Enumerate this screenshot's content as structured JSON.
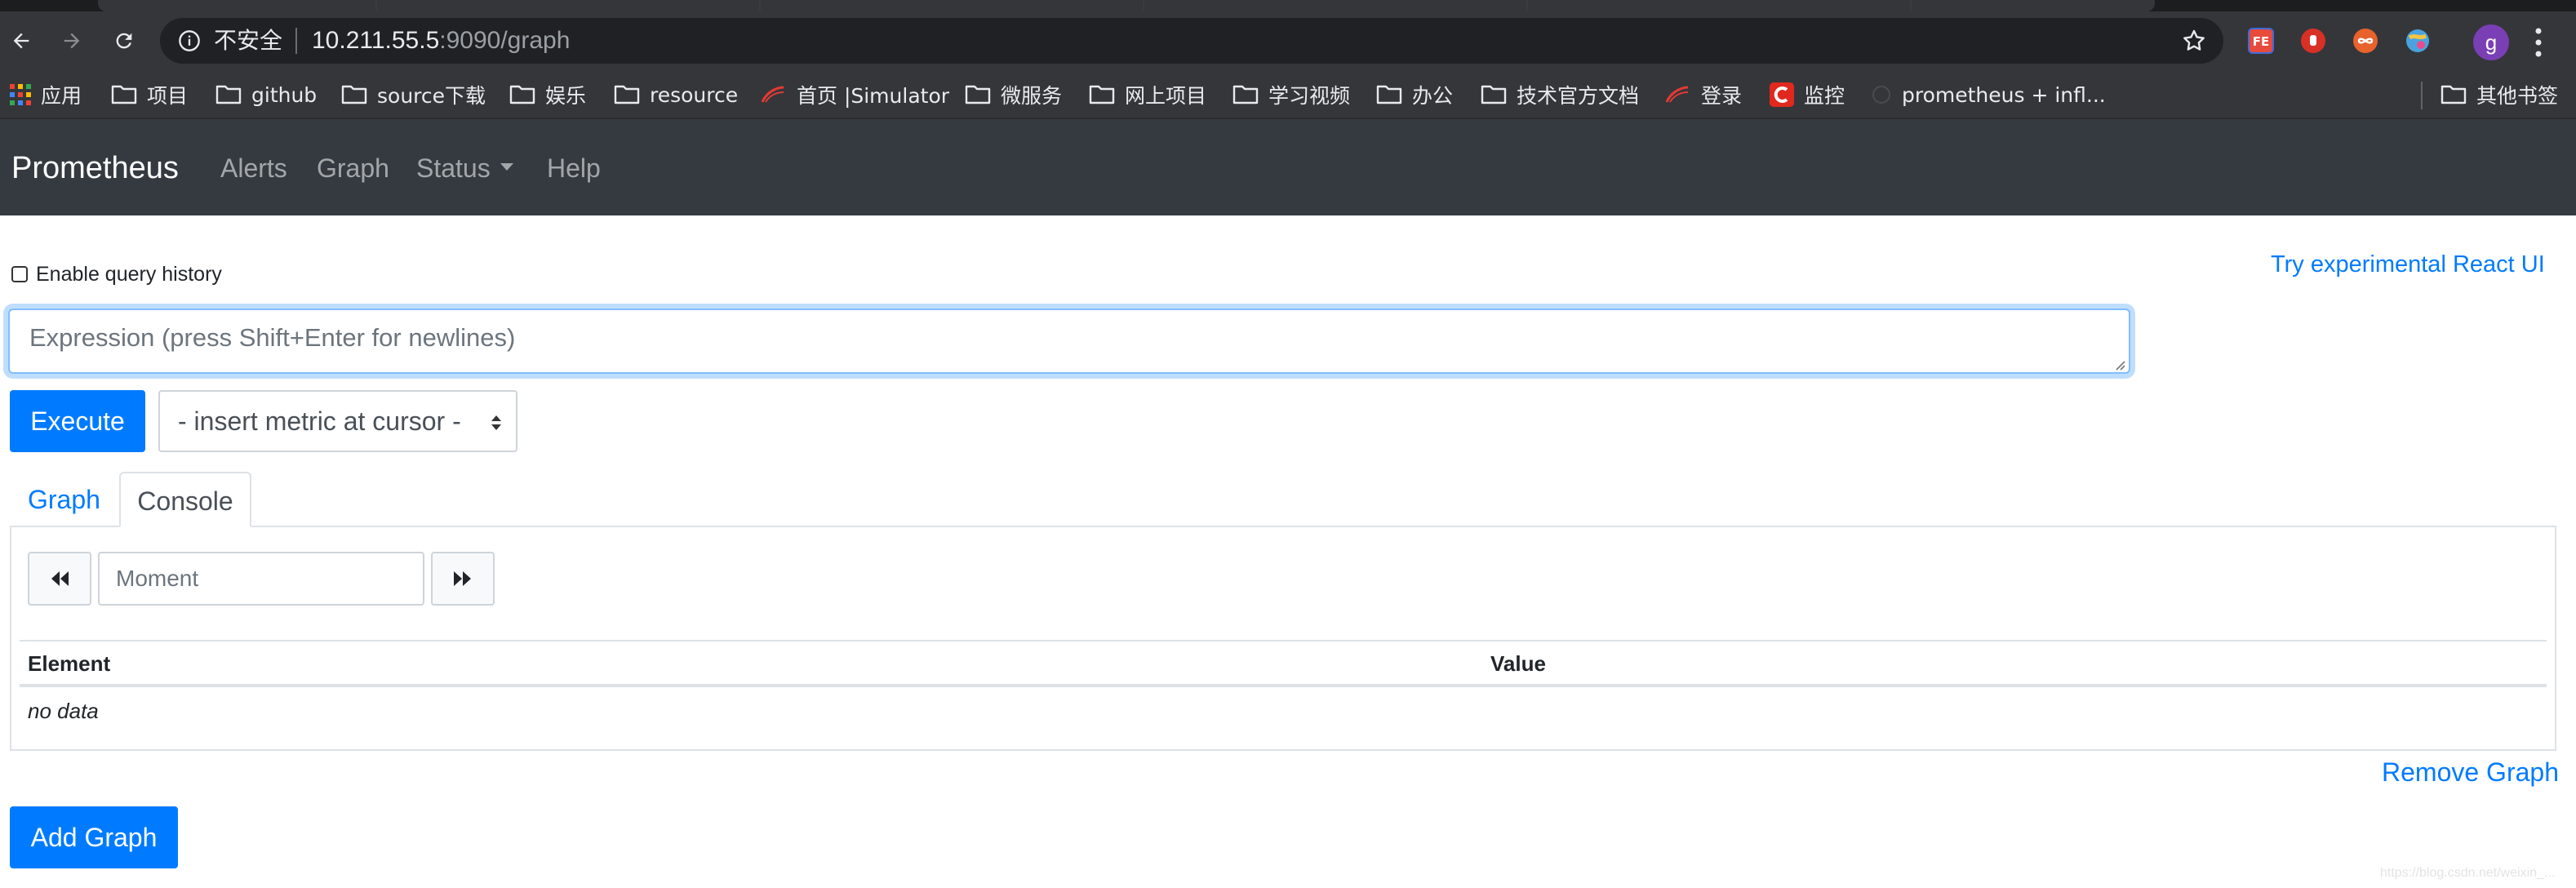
{
  "browser": {
    "omnibox": {
      "security_label": "不安全",
      "url_host": "10.211.55.5",
      "url_rest": ":9090/graph"
    },
    "profile_initial": "g",
    "bookmarks": [
      {
        "label": "应用",
        "icon": "apps-grid-icon"
      },
      {
        "label": "项目",
        "icon": "folder-icon"
      },
      {
        "label": "github",
        "icon": "folder-icon"
      },
      {
        "label": "source下载",
        "icon": "folder-icon"
      },
      {
        "label": "娱乐",
        "icon": "folder-icon"
      },
      {
        "label": "resource",
        "icon": "folder-icon"
      },
      {
        "label": "首页 |Simulator",
        "icon": "simulator-logo-icon"
      },
      {
        "label": "微服务",
        "icon": "folder-icon"
      },
      {
        "label": "网上项目",
        "icon": "folder-icon"
      },
      {
        "label": "学习视频",
        "icon": "folder-icon"
      },
      {
        "label": "办公",
        "icon": "folder-icon"
      },
      {
        "label": "技术官方文档",
        "icon": "folder-icon"
      },
      {
        "label": "登录",
        "icon": "simulator-logo-icon"
      },
      {
        "label": "监控",
        "icon": "csdn-logo-icon"
      },
      {
        "label": "prometheus + infl...",
        "icon": "page-icon"
      }
    ],
    "other_bookmarks": "其他书签"
  },
  "navbar": {
    "brand": "Prometheus",
    "links": {
      "alerts": "Alerts",
      "graph": "Graph",
      "status": "Status",
      "help": "Help"
    }
  },
  "main": {
    "history_label": "Enable query history",
    "react_link": "Try experimental React UI",
    "expression_placeholder": "Expression (press Shift+Enter for newlines)",
    "execute_label": "Execute",
    "metric_select": "- insert metric at cursor -",
    "tabs": {
      "graph": "Graph",
      "console": "Console"
    },
    "moment_placeholder": "Moment",
    "table": {
      "headers": {
        "element": "Element",
        "value": "Value"
      },
      "empty": "no data"
    },
    "remove_graph": "Remove Graph",
    "add_graph": "Add Graph"
  },
  "watermark": "https://blog.csdn.net/weixin_..."
}
